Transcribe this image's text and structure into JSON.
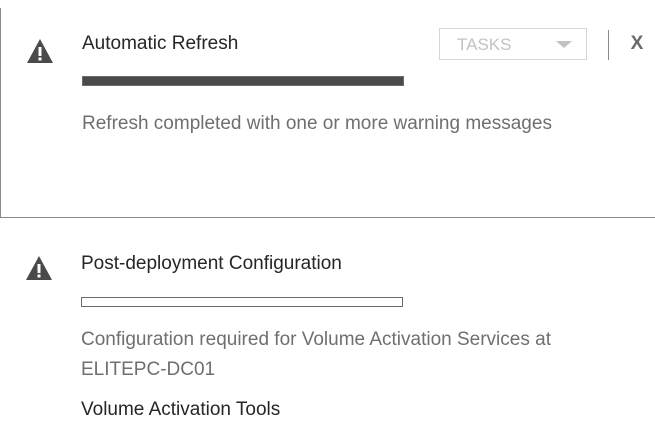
{
  "notifications": [
    {
      "icon": "warning-icon",
      "title": "Automatic Refresh",
      "progress": 1.0,
      "message": "Refresh completed with one or more warning messages",
      "tasks_label": "TASKS",
      "close_label": "X"
    },
    {
      "icon": "warning-icon",
      "title": "Post-deployment Configuration",
      "progress": 0.0,
      "message": "Configuration required for Volume Activation Services at ELITEPC-DC01",
      "link": "Volume Activation Tools"
    }
  ],
  "colors": {
    "progress_fill": "#4a4a4a",
    "progress_border": "#6c6c6c",
    "title_text": "#262626",
    "message_text": "#6f6f6f",
    "disabled_text": "#c2c2c2",
    "warning_icon": "#4a4a4a"
  }
}
